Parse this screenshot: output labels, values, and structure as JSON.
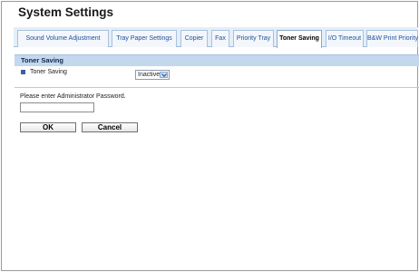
{
  "page": {
    "title": "System Settings"
  },
  "tabs": [
    {
      "label": "Sound Volume Adjustment",
      "active": false
    },
    {
      "label": "Tray Paper Settings",
      "active": false
    },
    {
      "label": "Copier",
      "active": false
    },
    {
      "label": "Fax",
      "active": false
    },
    {
      "label": "Priority Tray",
      "active": false
    },
    {
      "label": "Toner Saving",
      "active": true
    },
    {
      "label": "I/O Timeout",
      "active": false
    },
    {
      "label": "B&W Print Priority",
      "active": false
    }
  ],
  "section": {
    "title": "Toner Saving"
  },
  "setting": {
    "label": "Toner Saving",
    "value": "Inactive"
  },
  "password": {
    "prompt": "Please enter Administrator Password.",
    "value": ""
  },
  "buttons": {
    "ok": "OK",
    "cancel": "Cancel"
  },
  "colors": {
    "tab_bar": "#e3eef8",
    "tab_text": "#1f4f97",
    "section_bar": "#c3d7ee",
    "bullet": "#3a5fa6"
  },
  "icons": {
    "select_arrow": "chevron-down-icon",
    "bullet": "square-bullet-icon"
  }
}
